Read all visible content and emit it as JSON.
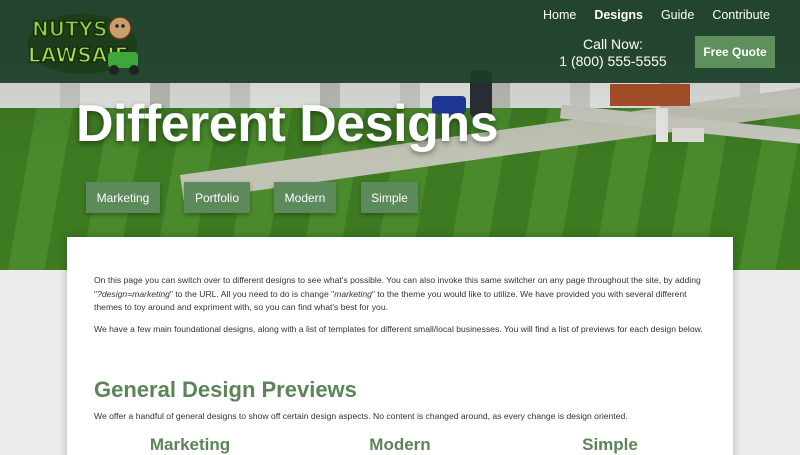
{
  "brand": {
    "logo_text": "NUTYS LAWSAIE"
  },
  "nav": {
    "items": [
      {
        "label": "Home",
        "active": false
      },
      {
        "label": "Designs",
        "active": true
      },
      {
        "label": "Guide",
        "active": false
      },
      {
        "label": "Contribute",
        "active": false
      }
    ]
  },
  "contact": {
    "call_label": "Call Now:",
    "phone": "1 (800) 555-5555",
    "quote_button": "Free Quote"
  },
  "hero": {
    "title": "Different Designs",
    "chips": [
      "Marketing",
      "Portfolio",
      "Modern",
      "Simple"
    ]
  },
  "content": {
    "para1_a": "On this page you can switch over to different designs to see what's possible. You can also invoke this same switcher on any page throughout the site, by adding \"",
    "para1_code1": "?design=marketing",
    "para1_b": "\" to the URL. All you need to do is change \"",
    "para1_code2": "marketing",
    "para1_c": "\" to the theme you would like to utilize. We have provided you with several different themes to toy around and expriment with, so you can find what's best for you.",
    "para2": "We have a few main foundational designs, along with a list of templates for different small/local businesses. You will find a list of previews for each design below.",
    "section_title": "General Design Previews",
    "section_desc": "We offer a handful of general designs to show off certain design aspects. No content is changed around, as every change is design oriented.",
    "columns": [
      "Marketing",
      "Modern",
      "Simple"
    ]
  },
  "colors": {
    "header_bg": "#1b3d27",
    "accent": "#5c8a5a",
    "title_green": "#5b8557"
  }
}
